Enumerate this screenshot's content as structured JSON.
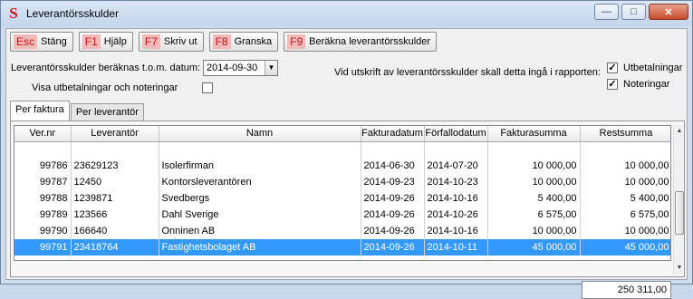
{
  "window": {
    "title": "Leverantörsskulder",
    "app_icon_letter": "S",
    "controls": {
      "minimize": "—",
      "maximize": "□",
      "close": "✕"
    }
  },
  "toolbar": {
    "buttons": [
      {
        "key": "Esc",
        "label": "Stäng"
      },
      {
        "key": "F1",
        "label": "Hjälp"
      },
      {
        "key": "F7",
        "label": "Skriv ut"
      },
      {
        "key": "F8",
        "label": "Granska"
      },
      {
        "key": "F9",
        "label": "Beräkna leverantörsskulder"
      }
    ]
  },
  "form": {
    "date_label": "Leverantörsskulder beräknas t.o.m. datum:",
    "date_value": "2014-09-30",
    "show_payments_label": "Visa utbetalningar och noteringar",
    "show_payments_checked": false,
    "report_label": "Vid utskrift av leverantörsskulder skall detta ingå i rapporten:",
    "payouts_label": "Utbetalningar",
    "payouts_checked": true,
    "notes_label": "Noteringar",
    "notes_checked": true
  },
  "tabs": [
    {
      "label": "Per faktura",
      "active": true
    },
    {
      "label": "Per leverantör",
      "active": false
    }
  ],
  "table": {
    "columns": [
      "Ver.nr",
      "Leverantör",
      "Namn",
      "Fakturadatum",
      "Förfallodatum",
      "Fakturasumma",
      "Restsumma"
    ],
    "rows": [
      {
        "ver": "99786",
        "lev": "23629123",
        "namn": "Isolerfirman",
        "fdatum": "2014-06-30",
        "forfall": "2014-07-20",
        "summa": "10 000,00",
        "rest": "10 000,00",
        "selected": false
      },
      {
        "ver": "99787",
        "lev": "12450",
        "namn": "Kontorsleverantören",
        "fdatum": "2014-09-23",
        "forfall": "2014-10-23",
        "summa": "10 000,00",
        "rest": "10 000,00",
        "selected": false
      },
      {
        "ver": "99788",
        "lev": "1239871",
        "namn": "Svedbergs",
        "fdatum": "2014-09-26",
        "forfall": "2014-10-16",
        "summa": "5 400,00",
        "rest": "5 400,00",
        "selected": false
      },
      {
        "ver": "99789",
        "lev": "123566",
        "namn": "Dahl Sverige",
        "fdatum": "2014-09-26",
        "forfall": "2014-10-26",
        "summa": "6 575,00",
        "rest": "6 575,00",
        "selected": false
      },
      {
        "ver": "99790",
        "lev": "166640",
        "namn": "Onninen AB",
        "fdatum": "2014-09-26",
        "forfall": "2014-10-16",
        "summa": "10 000,00",
        "rest": "10 000,00",
        "selected": false
      },
      {
        "ver": "99791",
        "lev": "23418764",
        "namn": "Fastighetsbolaget AB",
        "fdatum": "2014-09-26",
        "forfall": "2014-10-11",
        "summa": "45 000,00",
        "rest": "45 000,00",
        "selected": true
      }
    ],
    "total": "250 311,00"
  },
  "colors": {
    "selection": "#3399ff",
    "fkey_text": "#c0141a",
    "fkey_bg": "#f4b9b9"
  }
}
